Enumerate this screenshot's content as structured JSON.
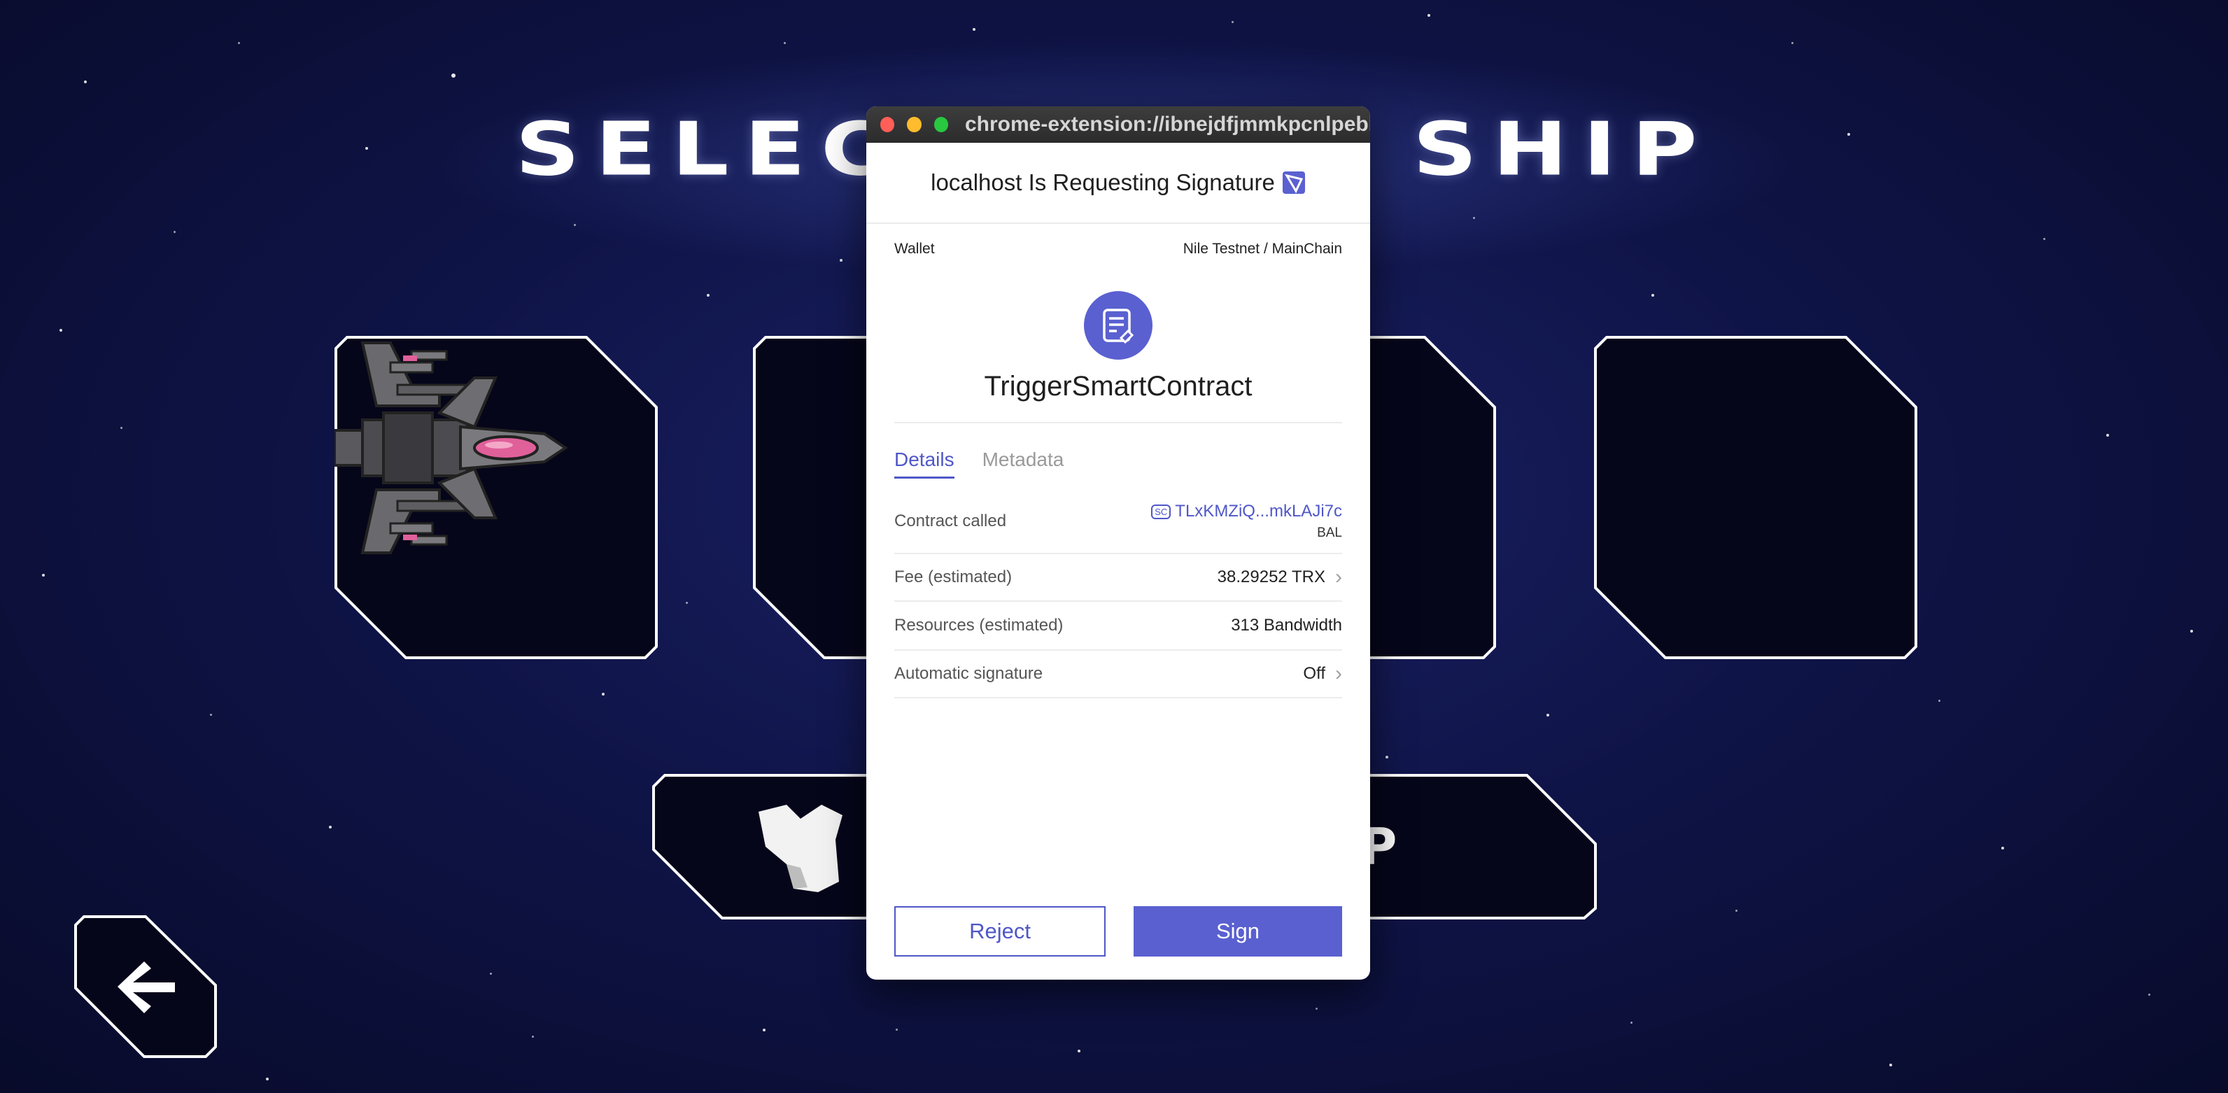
{
  "game": {
    "title": "SELECT YOUR SHIP",
    "select_button_label": "SELECT SHIP"
  },
  "popup": {
    "url": "chrome-extension://ibnejdfjmmkpcnlpebkl...",
    "header_title": "localhost Is Requesting Signature",
    "wallet_label": "Wallet",
    "network": "Nile Testnet / MainChain",
    "method_name": "TriggerSmartContract",
    "tabs": [
      {
        "label": "Details",
        "active": true
      },
      {
        "label": "Metadata",
        "active": false
      }
    ],
    "contract": {
      "label": "Contract called",
      "badge": "SC",
      "address": "TLxKMZiQ...mkLAJi7c",
      "token": "BAL"
    },
    "fee": {
      "label": "Fee (estimated)",
      "value": "38.29252 TRX"
    },
    "resources": {
      "label": "Resources (estimated)",
      "value": "313 Bandwidth"
    },
    "auto_sign": {
      "label": "Automatic signature",
      "value": "Off"
    },
    "reject_label": "Reject",
    "sign_label": "Sign"
  },
  "colors": {
    "accent": "#5a60d0",
    "link": "#4f57c8",
    "background": "#0f1448"
  },
  "icons": [
    "back-arrow-icon",
    "contract-document-icon",
    "tronlink-icon",
    "chevron-right-icon"
  ]
}
